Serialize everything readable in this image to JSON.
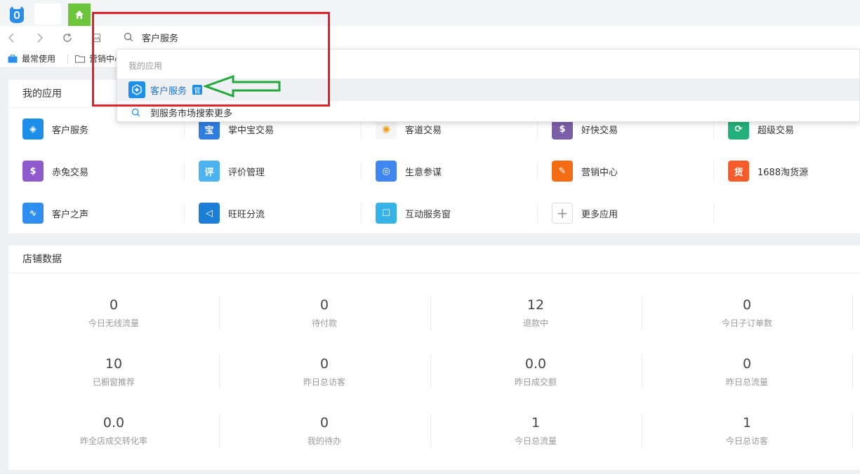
{
  "nav": {
    "back_icon": "chevron-left-icon",
    "forward_icon": "chevron-right-icon",
    "refresh_icon": "refresh-icon",
    "search_value": "客户服务"
  },
  "bookmarks": [
    {
      "label": "最常使用",
      "icon": "briefcase-icon"
    },
    {
      "label": "营销中心",
      "icon": "folder-icon"
    }
  ],
  "apps": {
    "title": "我的应用",
    "items": [
      {
        "label": "客户服务",
        "color": "#1e8fe8"
      },
      {
        "label": "掌中宝交易",
        "color": "#2f7de1"
      },
      {
        "label": "客道交易",
        "color": "#f5f5f5"
      },
      {
        "label": "好快交易",
        "color": "#7b5ea7"
      },
      {
        "label": "超级交易",
        "color": "#23b07b"
      },
      {
        "label": "赤兔交易",
        "color": "#8f5bcc"
      },
      {
        "label": "评价管理",
        "color": "#4db3f0"
      },
      {
        "label": "生意参谋",
        "color": "#3f86f0"
      },
      {
        "label": "营销中心",
        "color": "#f36b12"
      },
      {
        "label": "1688淘货源",
        "color": "#f85b2a"
      },
      {
        "label": "客户之声",
        "color": "#2f8ff0"
      },
      {
        "label": "旺旺分流",
        "color": "#1b7fd8"
      },
      {
        "label": "互动服务窗",
        "color": "#37b3ea"
      },
      {
        "label": "更多应用",
        "color": "#ffffff"
      }
    ]
  },
  "store": {
    "title": "店铺数据",
    "cells": [
      {
        "value": "0",
        "label": "今日无线流量"
      },
      {
        "value": "0",
        "label": "待付款"
      },
      {
        "value": "12",
        "label": "退款中"
      },
      {
        "value": "0",
        "label": "今日子订单数"
      },
      {
        "value": "10",
        "label": "已橱窗推荐"
      },
      {
        "value": "0",
        "label": "昨日总访客"
      },
      {
        "value": "0.0",
        "label": "昨日成交额"
      },
      {
        "value": "0",
        "label": "昨日总流量"
      },
      {
        "value": "0.0",
        "label": "昨全店成交转化率"
      },
      {
        "value": "0",
        "label": "我的待办"
      },
      {
        "value": "1",
        "label": "今日总流量"
      },
      {
        "value": "1",
        "label": "今日总访客"
      }
    ]
  },
  "dropdown": {
    "section": "我的应用",
    "result": "客户服务",
    "badge": "官",
    "more": "到服务市场搜索更多"
  },
  "colors": {
    "accent": "#1e8fe8",
    "annotation_box": "#e0202a",
    "annotation_arrow": "#22a83a",
    "home_tab": "#6ec43a"
  }
}
